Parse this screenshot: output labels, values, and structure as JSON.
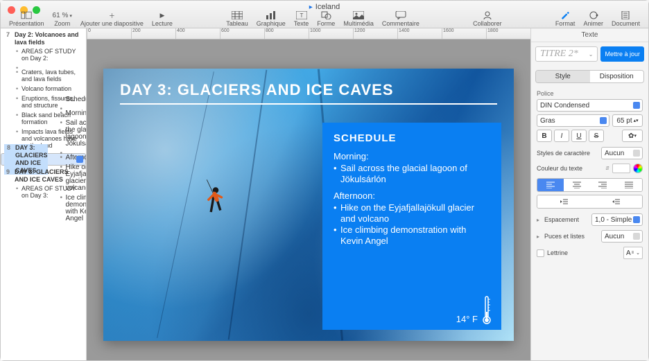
{
  "doc_title": "Iceland",
  "toolbar": {
    "presentation": "Présentation",
    "zoom": "Zoom",
    "zoom_value": "61 %",
    "add_slide": "Ajouter une diapositive",
    "play": "Lecture",
    "table": "Tableau",
    "chart": "Graphique",
    "text": "Texte",
    "shape": "Forme",
    "media": "Multimédia",
    "comment": "Commentaire",
    "collaborate": "Collaborer",
    "format": "Format",
    "animate": "Animer",
    "document": "Document"
  },
  "ruler": [
    "0",
    "200",
    "400",
    "600",
    "800",
    "1000",
    "1200",
    "1400",
    "1600",
    "1800"
  ],
  "outline": [
    {
      "num": "7",
      "title": "Day 2: Volcanoes and lava fields",
      "selected": false,
      "items": [
        "AREAS OF STUDY on Day 2:",
        "",
        "Craters, lava tubes, and lava fields",
        "Volcano formation",
        "Eruptions, fissures, and structure",
        "Black sand beach formation",
        "Impacts lava fields and volcanoes have on the land"
      ]
    },
    {
      "num": "8",
      "title": "DAY 3: GLACIERS AND ICE CAVES",
      "selected": true,
      "items": [
        "Schedule",
        "",
        "Morning:",
        "Sail across the glacial lagoon of Jökulsárlón",
        "",
        "Afternoon:",
        "Hike on the Eyjafjallajökull glacier and volcano",
        "Ice climbing demonstration with Kevin Angel"
      ]
    },
    {
      "num": "9",
      "title": "DAY 3: GLACIERS AND ICE CAVES",
      "selected": false,
      "items": [
        "AREAS OF STUDY on Day 3:"
      ]
    }
  ],
  "slide": {
    "title": "DAY 3: GLACIERS AND ICE CAVES",
    "schedule_label": "SCHEDULE",
    "morning_label": "Morning:",
    "morning_items": [
      "Sail across the glacial lagoon of Jökulsárlón"
    ],
    "afternoon_label": "Afternoon:",
    "afternoon_items": [
      "Hike on the Eyjafjallajökull glacier and volcano",
      "Ice climbing demonstration with Kevin Angel"
    ],
    "temperature": "14° F"
  },
  "inspector": {
    "text_header": "Texte",
    "paragraph_style": "TITRE 2*",
    "update": "Mettre à jour",
    "tab_style": "Style",
    "tab_layout": "Disposition",
    "font_label": "Police",
    "font_family": "DIN Condensed",
    "font_weight": "Gras",
    "font_size": "65 pt",
    "char_styles_label": "Styles de caractère",
    "char_styles_value": "Aucun",
    "text_color_label": "Couleur du texte",
    "spacing_label": "Espacement",
    "spacing_value": "1,0 - Simple",
    "bullets_label": "Puces et listes",
    "bullets_value": "Aucun",
    "dropcap_label": "Lettrine",
    "dropcap_glyph": "A"
  }
}
